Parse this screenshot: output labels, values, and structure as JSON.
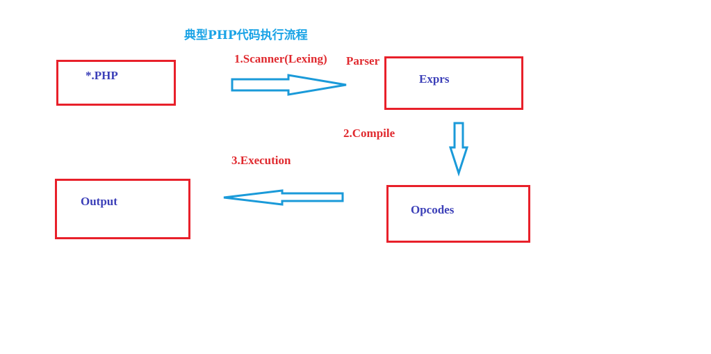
{
  "title": "典型PHP代码执行流程",
  "nodes": {
    "php_file": "*.PHP",
    "exprs": "Exprs",
    "opcodes": "Opcodes",
    "output": "Output"
  },
  "steps": {
    "scanner": "1.Scanner(Lexing)",
    "parser": "Parser",
    "compile": "2.Compile",
    "execution": "3.Execution"
  },
  "colors": {
    "box_border": "#e8202a",
    "node_text": "#3b3fb8",
    "step_text": "#e02a2f",
    "title_text": "#1aa3e6",
    "arrow_stroke": "#1a9ad9"
  }
}
